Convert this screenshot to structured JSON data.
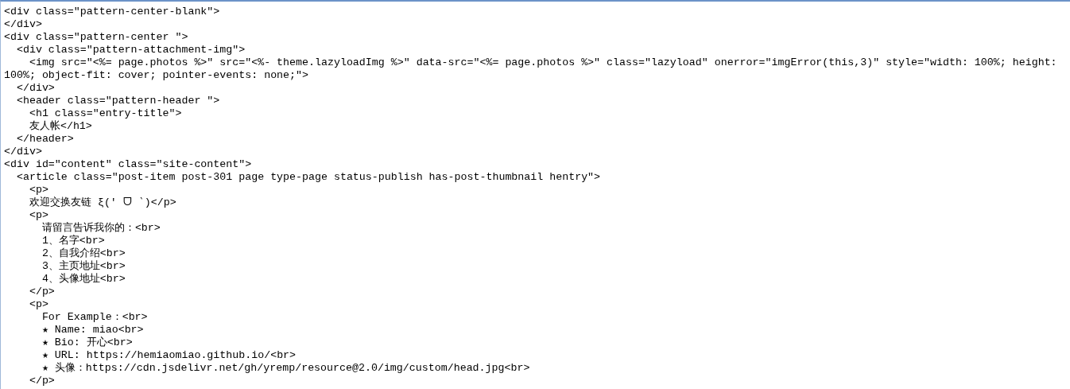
{
  "source_lines": [
    "<div class=\"pattern-center-blank\">",
    "</div>",
    "<div class=\"pattern-center \">",
    "  <div class=\"pattern-attachment-img\">",
    "    <img src=\"<%= page.photos %>\" src=\"<%- theme.lazyloadImg %>\" data-src=\"<%= page.photos %>\" class=\"lazyload\" onerror=\"imgError(this,3)\" style=\"width: 100%; height:",
    "100%; object-fit: cover; pointer-events: none;\">",
    "  </div>",
    "  <header class=\"pattern-header \">",
    "    <h1 class=\"entry-title\">",
    "    友人帐</h1>",
    "  </header>",
    "</div>",
    "<div id=\"content\" class=\"site-content\">",
    "  <article class=\"post-item post-301 page type-page status-publish has-post-thumbnail hentry\">",
    "    <p>",
    "    欢迎交换友链 ξ(′ ᗜ ‵)</p>",
    "    <p>",
    "      请留言告诉我你的：<br>",
    "      1、名字<br>",
    "      2、自我介绍<br>",
    "      3、主页地址<br>",
    "      4、头像地址<br>",
    "    </p>",
    "    <p>",
    "      For Example：<br>",
    "      ★ Name: miao<br>",
    "      ★ Bio: 开心<br>",
    "      ★ URL: https://hemiaomiao.github.io/<br>",
    "      ★ 头像：https://cdn.jsdelivr.net/gh/yremp/resource@2.0/img/custom/head.jpg<br>",
    "    </p>"
  ]
}
